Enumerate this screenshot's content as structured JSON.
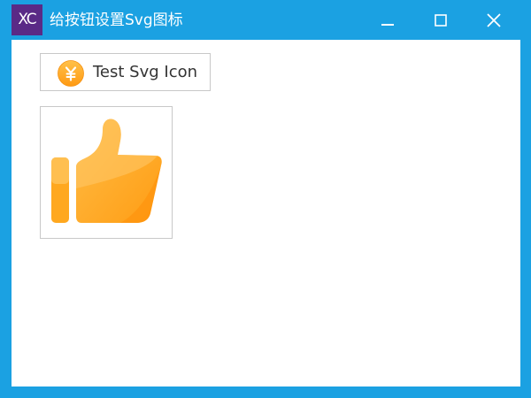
{
  "window": {
    "logo_text": "XC",
    "title": "给按钮设置Svg图标"
  },
  "controls": {
    "minimize_icon": "minimize-icon",
    "maximize_icon": "maximize-icon",
    "close_icon": "close-icon"
  },
  "content": {
    "test_button": {
      "label": "Test Svg Icon",
      "icon": "yuan-coin-icon"
    },
    "icon_button": {
      "icon": "thumbs-up-icon"
    }
  },
  "colors": {
    "titlebar": "#1ba1e2",
    "logo_bg": "#5a2a86",
    "icon_orange": "#ffa51c"
  }
}
